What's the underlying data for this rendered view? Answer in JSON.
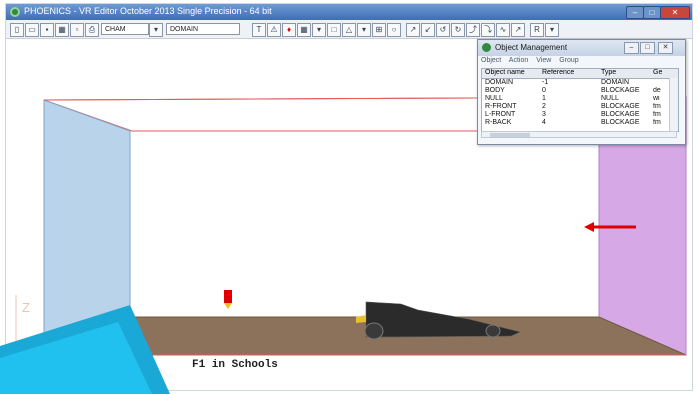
{
  "window": {
    "title": "PHOENICS - VR Editor October 2013 Single Precision - 64 bit",
    "controls": {
      "minimize": "–",
      "maximize": "□",
      "close": "✕"
    }
  },
  "toolbar": {
    "object_select": "CHAM",
    "domain_select": "DOMAIN",
    "font_button": "T",
    "r_button": "R"
  },
  "viewport": {
    "caption": "F1 in Schools",
    "axis_label": "Z",
    "colors": {
      "left_wall": "#b9d4ea",
      "right_wall": "#d7a8e6",
      "floor": "#8c725a",
      "box_edges": "#e25a5a",
      "inlet_arrow": "#e00000",
      "probe": "#e00000"
    }
  },
  "object_management": {
    "title": "Object Management",
    "menu": [
      "Object",
      "Action",
      "View",
      "Group"
    ],
    "columns": [
      "Object name",
      "Reference",
      "Type",
      "Ge"
    ],
    "rows": [
      {
        "name": "DOMAIN",
        "reference": "-1",
        "type": "DOMAIN",
        "ge": ""
      },
      {
        "name": "BODY",
        "reference": "0",
        "type": "BLOCKAGE",
        "ge": "de"
      },
      {
        "name": "NULL",
        "reference": "1",
        "type": "NULL",
        "ge": "wi"
      },
      {
        "name": "R-FRONT",
        "reference": "2",
        "type": "BLOCKAGE",
        "ge": "fm"
      },
      {
        "name": "L-FRONT",
        "reference": "3",
        "type": "BLOCKAGE",
        "ge": "fm"
      },
      {
        "name": "R-BACK",
        "reference": "4",
        "type": "BLOCKAGE",
        "ge": "fm"
      }
    ]
  }
}
